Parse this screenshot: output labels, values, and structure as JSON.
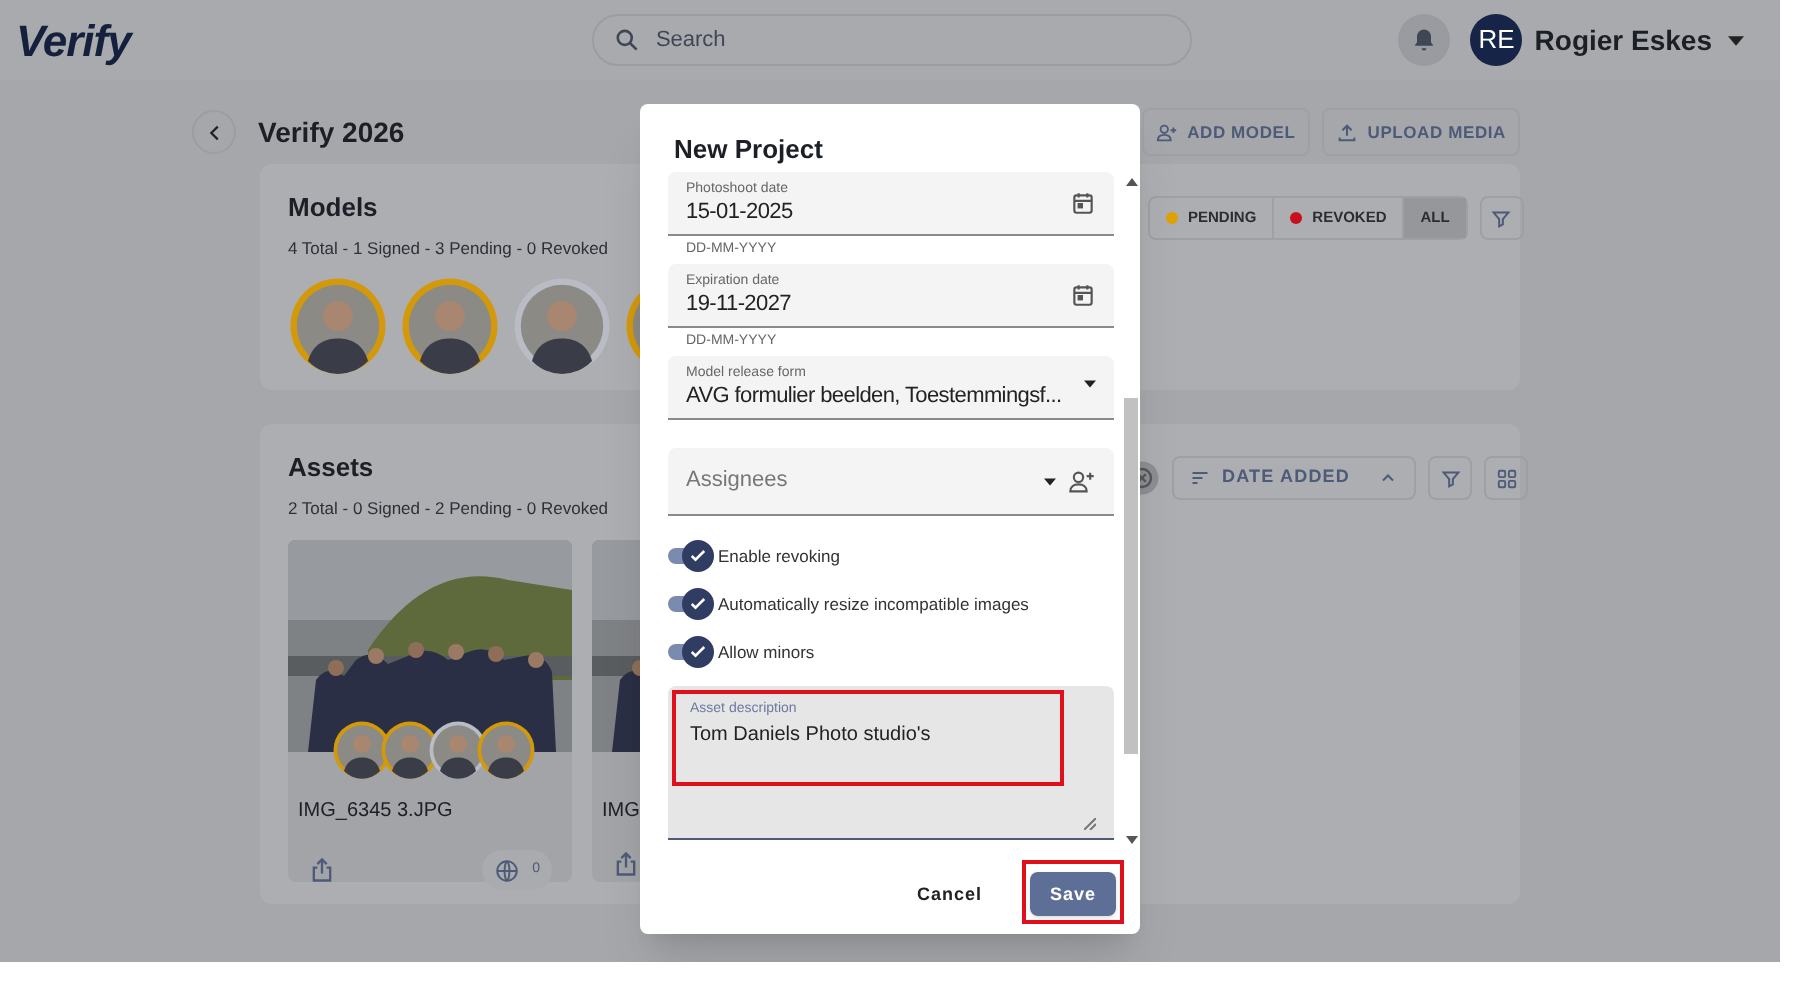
{
  "header": {
    "logo": "Verify",
    "search": {
      "placeholder": "Search"
    },
    "user": {
      "initials": "RE",
      "name": "Rogier Eskes"
    }
  },
  "project": {
    "title": "Verify 2026",
    "actions": [
      {
        "kind": "add-person",
        "label": "ADD MODEL"
      },
      {
        "kind": "upload",
        "label": "UPLOAD MEDIA"
      }
    ]
  },
  "models": {
    "title": "Models",
    "summary": "4 Total - 1 Signed - 3 Pending - 0 Revoked",
    "filters": [
      {
        "label": "PENDING",
        "color": "#e0a106",
        "selected": false
      },
      {
        "label": "REVOKED",
        "color": "#c8101c",
        "selected": false
      },
      {
        "label": "ALL",
        "selected": true
      }
    ],
    "avatars": [
      {
        "pending": true
      },
      {
        "pending": true
      },
      {
        "pending": false
      },
      {
        "pending": true
      }
    ]
  },
  "assets": {
    "title": "Assets",
    "summary": "2 Total - 0 Signed - 2 Pending - 0 Revoked",
    "sort": "DATE ADDED",
    "items": [
      {
        "name": "IMG_6345 3.JPG",
        "count": "0",
        "avatars": [
          {
            "pending": true
          },
          {
            "pending": true
          },
          {
            "pending": false
          },
          {
            "pending": true
          }
        ]
      },
      {
        "name": "IMG"
      }
    ]
  },
  "dialog": {
    "title": "New Project",
    "fields": [
      {
        "kind": "date",
        "label": "Photoshoot date",
        "value": "15-01-2025",
        "helper": "DD-MM-YYYY"
      },
      {
        "kind": "date",
        "label": "Expiration date",
        "value": "19-11-2027",
        "helper": "DD-MM-YYYY"
      },
      {
        "kind": "select",
        "label": "Model release form",
        "value": "AVG formulier beelden, Toestemmingsf..."
      },
      {
        "kind": "people",
        "placeholder": "Assignees"
      }
    ],
    "toggles": [
      {
        "label": "Enable revoking",
        "on": true
      },
      {
        "label": "Automatically resize incompatible images",
        "on": true
      },
      {
        "label": "Allow minors",
        "on": true
      }
    ],
    "description": {
      "label": "Asset description",
      "value": "Tom Daniels Photo studio's",
      "highlighted": true
    },
    "buttons": [
      {
        "kind": "text",
        "label": "Cancel",
        "highlighted": false
      },
      {
        "kind": "primary",
        "label": "Save",
        "highlighted": true
      }
    ]
  }
}
